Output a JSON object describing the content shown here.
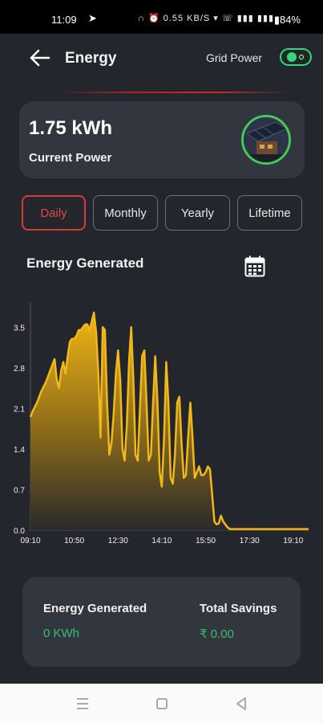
{
  "status_bar": {
    "time": "11:09",
    "icons": "∩ ⏰ 0.55 KB/S ▾ ☏ ▮▮▮ ▮▮▮",
    "battery": "84%"
  },
  "header": {
    "title": "Energy",
    "grid_power_label": "Grid Power",
    "grid_power_on": true
  },
  "power_card": {
    "value": "1.75 kWh",
    "label": "Current Power"
  },
  "tabs": [
    {
      "label": "Daily",
      "active": true
    },
    {
      "label": "Monthly",
      "active": false
    },
    {
      "label": "Yearly",
      "active": false
    },
    {
      "label": "Lifetime",
      "active": false
    }
  ],
  "section_title": "Energy Generated",
  "chart_data": {
    "type": "area",
    "title": "",
    "xlabel": "",
    "ylabel": "",
    "x_ticks": [
      "09:10",
      "10:50",
      "12:30",
      "14:10",
      "15:50",
      "17:30",
      "19:10"
    ],
    "y_ticks": [
      "0.0",
      "0.7",
      "1.4",
      "2.1",
      "2.8",
      "3.5"
    ],
    "ylim": [
      0,
      3.85
    ],
    "xlim": [
      "09:10",
      "19:45"
    ],
    "color": "#e8b21a",
    "series": [
      {
        "x": [
          "09:10",
          "09:15",
          "09:25",
          "09:35",
          "09:45",
          "09:55",
          "10:05",
          "10:10",
          "10:15",
          "10:20",
          "10:25",
          "10:30",
          "10:35",
          "10:40",
          "10:45",
          "10:50",
          "10:55",
          "11:00",
          "11:05",
          "11:10",
          "11:15",
          "11:20",
          "11:25",
          "11:30",
          "11:35",
          "11:40",
          "11:45",
          "11:50",
          "11:55",
          "12:00",
          "12:05",
          "12:10",
          "12:15",
          "12:20",
          "12:25",
          "12:30",
          "12:35",
          "12:40",
          "12:45",
          "12:50",
          "12:55",
          "13:00",
          "13:05",
          "13:10",
          "13:15",
          "13:20",
          "13:25",
          "13:30",
          "13:35",
          "13:40",
          "13:45",
          "13:50",
          "13:55",
          "14:00",
          "14:05",
          "14:10",
          "14:15",
          "14:20",
          "14:25",
          "14:30",
          "14:35",
          "14:40",
          "14:45",
          "14:50",
          "14:55",
          "15:00",
          "15:05",
          "15:10",
          "15:15",
          "15:20",
          "15:25",
          "15:30",
          "15:35",
          "15:40",
          "15:45",
          "15:50",
          "15:55",
          "16:00",
          "16:05",
          "16:10",
          "16:15",
          "16:20",
          "16:25",
          "16:30",
          "16:35",
          "16:40",
          "16:45",
          "16:50",
          "16:55",
          "17:00",
          "17:05",
          "17:10",
          "17:15",
          "17:20",
          "17:25",
          "17:30",
          "17:35",
          "17:40",
          "17:50",
          "18:00",
          "18:30",
          "19:00",
          "19:30",
          "19:45"
        ],
        "y": [
          1.95,
          2.05,
          2.2,
          2.4,
          2.55,
          2.75,
          2.95,
          2.6,
          2.45,
          2.75,
          2.9,
          2.7,
          3.0,
          3.25,
          3.3,
          3.3,
          3.35,
          3.45,
          3.45,
          3.5,
          3.55,
          3.55,
          3.45,
          3.6,
          3.75,
          3.4,
          2.7,
          1.6,
          3.5,
          3.45,
          2.2,
          1.3,
          1.5,
          2.0,
          2.7,
          3.1,
          2.6,
          1.4,
          1.2,
          1.8,
          2.9,
          3.5,
          2.6,
          1.3,
          1.2,
          2.1,
          3.0,
          3.1,
          2.2,
          1.2,
          1.3,
          2.2,
          3.0,
          2.2,
          1.0,
          0.75,
          1.6,
          2.9,
          2.2,
          0.9,
          0.8,
          1.3,
          2.2,
          2.3,
          1.5,
          0.9,
          0.95,
          1.6,
          2.2,
          1.6,
          0.9,
          1.0,
          1.1,
          0.95,
          0.95,
          1.0,
          1.1,
          1.05,
          0.6,
          0.15,
          0.1,
          0.12,
          0.25,
          0.15,
          0.1,
          0.05,
          0.02,
          0.02,
          0.02,
          0.02,
          0.02,
          0.02,
          0.02,
          0.02,
          0.02,
          0.02,
          0.02,
          0.02,
          0.02,
          0.02,
          0.02,
          0.02,
          0.02,
          0.02
        ]
      }
    ]
  },
  "summary": {
    "energy_label": "Energy Generated",
    "energy_value": "0 KWh",
    "savings_label": "Total Savings",
    "savings_value": "₹ 0.00"
  }
}
